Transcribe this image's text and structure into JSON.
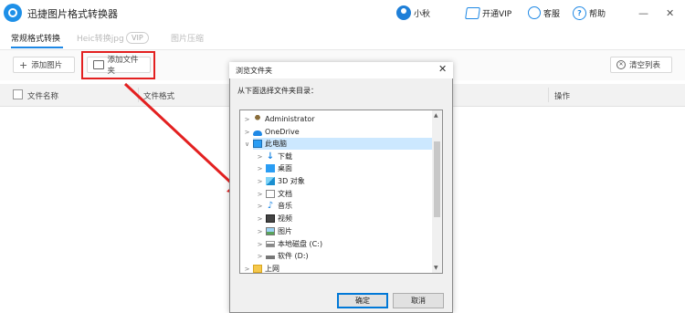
{
  "app": {
    "title": "迅捷图片格式转换器"
  },
  "titlebar": {
    "user": "小秋",
    "vip": "开通VIP",
    "service": "客服",
    "help": "帮助",
    "minimize": "—",
    "close": "✕"
  },
  "tabs": [
    {
      "label": "常规格式转换"
    },
    {
      "label": "Heic转换jpg"
    },
    {
      "label": "图片压缩"
    }
  ],
  "tab_badge": "VIP",
  "toolbar": {
    "add_image": "添加图片",
    "add_folder": "添加文件夹",
    "clear_list": "清空列表"
  },
  "table": {
    "columns": [
      "文件名称",
      "文件格式",
      "操作"
    ]
  },
  "dialog": {
    "title": "浏览文件夹",
    "close": "✕",
    "description": "从下面选择文件夹目录：",
    "ok": "确定",
    "cancel": "取消",
    "tree": [
      {
        "label": "Administrator",
        "icon": "user-folder-icon",
        "level": 0,
        "expander": ">"
      },
      {
        "label": "OneDrive",
        "icon": "cloud-icon",
        "level": 0,
        "expander": ">"
      },
      {
        "label": "此电脑",
        "icon": "computer-icon",
        "level": 0,
        "expander": "∨"
      },
      {
        "label": "下载",
        "icon": "download-icon",
        "level": 1,
        "expander": ">"
      },
      {
        "label": "桌面",
        "icon": "desktop-icon",
        "level": 1,
        "expander": ">"
      },
      {
        "label": "3D 对象",
        "icon": "cube-icon",
        "level": 1,
        "expander": ">"
      },
      {
        "label": "文档",
        "icon": "document-icon",
        "level": 1,
        "expander": ">"
      },
      {
        "label": "音乐",
        "icon": "music-icon",
        "level": 1,
        "expander": ">"
      },
      {
        "label": "视频",
        "icon": "video-icon",
        "level": 1,
        "expander": ">"
      },
      {
        "label": "图片",
        "icon": "picture-icon",
        "level": 1,
        "expander": ">"
      },
      {
        "label": "本地磁盘 (C:)",
        "icon": "drive-icon",
        "level": 1,
        "expander": ">"
      },
      {
        "label": "软件 (D:)",
        "icon": "drive-icon",
        "level": 1,
        "expander": ">"
      },
      {
        "label": "上网",
        "icon": "folder-icon",
        "level": 0,
        "expander": ">"
      }
    ]
  },
  "colors": {
    "accent": "#1e88e5",
    "highlight_red": "#e32020",
    "tree_selection": "#cce8ff"
  }
}
